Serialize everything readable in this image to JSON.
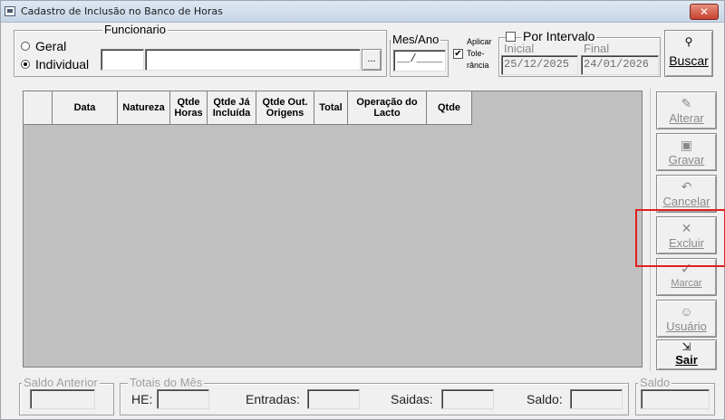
{
  "window": {
    "title": "Cadastro de Inclusão no Banco de Horas",
    "close_label": "✕"
  },
  "mode": {
    "options": [
      {
        "label": "Geral",
        "selected": false
      },
      {
        "label": "Individual",
        "selected": true
      }
    ]
  },
  "funcionario": {
    "title": "Funcionario",
    "code": "",
    "name": "",
    "lookup_label": "..."
  },
  "mes_ano": {
    "title": "Mes/Ano",
    "value": "__/____"
  },
  "tolerancia": {
    "line1": "Aplicar",
    "line2": "Tole-",
    "line3": "rância",
    "checked": true
  },
  "intervalo": {
    "title": "Por Intervalo",
    "checked": false,
    "inicial_label": "Inicial",
    "inicial_value": "25/12/2025",
    "final_label": "Final",
    "final_value": "24/01/2026"
  },
  "buscar": {
    "label": "Buscar"
  },
  "grid": {
    "columns": [
      "",
      "Data",
      "Natureza",
      "Qtde Horas",
      "Qtde Já Incluída",
      "Qtde Out. Origens",
      "Total",
      "Operação do Lacto",
      "Qtde"
    ]
  },
  "actions": {
    "alterar": "Alterar",
    "gravar": "Gravar",
    "cancelar": "Cancelar",
    "excluir": "Excluir",
    "marcar": "Marcar",
    "usuario": "Usuário",
    "sair": "Sair"
  },
  "footer": {
    "saldo_anterior_title": "Saldo Anterior",
    "totais_title": "Totais do Mês",
    "he_label": "HE:",
    "entradas_label": "Entradas:",
    "saidas_label": "Saidas:",
    "saldo_label": "Saldo:",
    "saldo_title": "Saldo"
  }
}
